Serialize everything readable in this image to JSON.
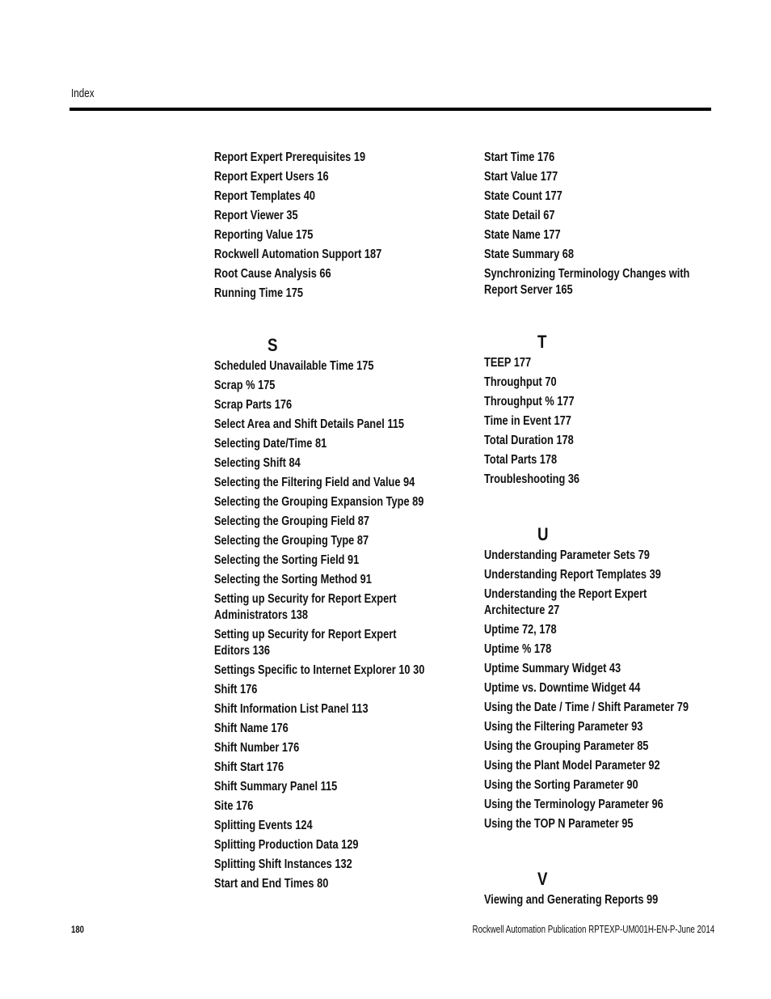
{
  "header": {
    "section_label": "Index"
  },
  "left_column": {
    "continued_entries": [
      "Report Expert Prerequisites 19",
      "Report Expert Users 16",
      "Report Templates 40",
      "Report Viewer 35",
      "Reporting Value 175",
      "Rockwell Automation Support 187",
      "Root Cause Analysis 66",
      "Running Time 175"
    ],
    "section_s": {
      "letter": "S",
      "entries": [
        "Scheduled Unavailable Time 175",
        "Scrap % 175",
        "Scrap Parts 176",
        "Select Area and Shift Details Panel 115",
        "Selecting Date/Time 81",
        "Selecting Shift 84",
        "Selecting the Filtering Field and Value 94",
        "Selecting the Grouping Expansion Type 89",
        "Selecting the Grouping Field 87",
        "Selecting the Grouping Type 87",
        "Selecting the Sorting Field 91",
        "Selecting the Sorting Method 91",
        "Setting up Security for Report Expert Administrators 138",
        "Setting up Security for Report Expert Editors 136",
        "Settings Specific to Internet Explorer 10 30",
        "Shift 176",
        "Shift Information List Panel 113",
        "Shift Name 176",
        "Shift Number 176",
        "Shift Start 176",
        "Shift Summary Panel 115",
        "Site 176",
        "Splitting Events 124",
        "Splitting Production Data 129",
        "Splitting Shift Instances 132",
        "Start and End Times 80"
      ]
    }
  },
  "right_column": {
    "continued_entries": [
      "Start Time 176",
      "Start Value 177",
      "State Count 177",
      "State Detail 67",
      "State Name 177",
      "State Summary 68",
      "Synchronizing Terminology Changes with Report Server 165"
    ],
    "section_t": {
      "letter": "T",
      "entries": [
        "TEEP 177",
        "Throughput 70",
        "Throughput % 177",
        "Time in Event 177",
        "Total Duration 178",
        "Total Parts 178",
        "Troubleshooting 36"
      ]
    },
    "section_u": {
      "letter": "U",
      "entries": [
        "Understanding Parameter Sets 79",
        "Understanding Report Templates 39",
        "Understanding the Report Expert Architecture 27",
        "Uptime 72, 178",
        "Uptime % 178",
        "Uptime Summary Widget 43",
        "Uptime vs. Downtime Widget 44",
        "Using the Date / Time / Shift Parameter 79",
        "Using the Filtering Parameter 93",
        "Using the Grouping Parameter 85",
        "Using the Plant Model Parameter 92",
        "Using the Sorting Parameter 90",
        "Using the Terminology Parameter 96",
        "Using the TOP N Parameter 95"
      ]
    },
    "section_v": {
      "letter": "V",
      "entries": [
        "Viewing and Generating Reports 99"
      ]
    }
  },
  "footer": {
    "page_number": "180",
    "publication": "Rockwell Automation Publication RPTEXP-UM001H-EN-P-June 2014"
  }
}
